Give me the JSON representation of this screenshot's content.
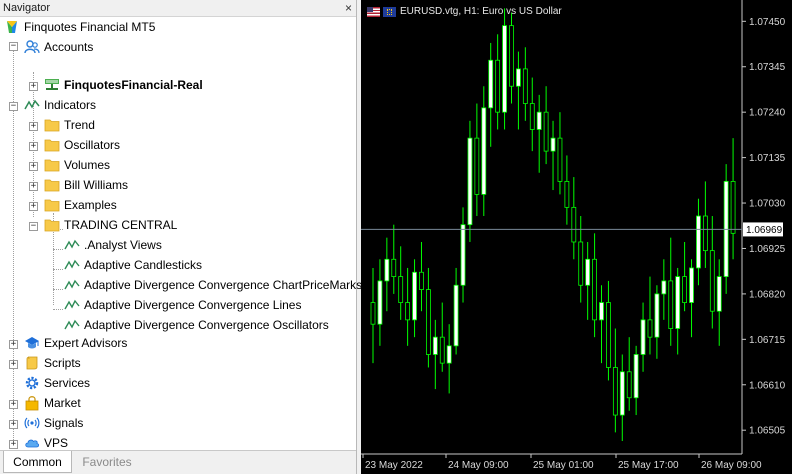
{
  "navigator": {
    "title": "Navigator",
    "close_glyph": "×",
    "root_label": "Finquotes Financial MT5",
    "accounts": {
      "label": "Accounts",
      "account_name": "FinquotesFinancial-Real"
    },
    "indicators": {
      "label": "Indicators",
      "folders": [
        "Trend",
        "Oscillators",
        "Volumes",
        "Bill Williams",
        "Examples",
        "TRADING CENTRAL"
      ],
      "trading_central_items": [
        ".Analyst Views",
        "Adaptive Candlesticks",
        "Adaptive Divergence Convergence ChartPriceMarks",
        "Adaptive Divergence Convergence Lines",
        "Adaptive Divergence Convergence Oscillators"
      ]
    },
    "other_nodes": [
      "Expert Advisors",
      "Scripts",
      "Services",
      "Market",
      "Signals",
      "VPS"
    ],
    "tabs": {
      "common": "Common",
      "favorites": "Favorites"
    }
  },
  "chart": {
    "symbol_title": "EURUSD.vtg, H1:  Euro vs US Dollar",
    "colors": {
      "background": "#000000",
      "bull_candle": "#ffffff",
      "bull_fill": "#00ff00",
      "price_line": "#7a8a99",
      "axis_text": "#d8d8d8",
      "current_price_bg": "#ffffff"
    },
    "current_price": "1.06969",
    "chart_data": {
      "type": "candlestick",
      "title": "EURUSD.vtg, H1:  Euro vs US Dollar",
      "y_ticks": [
        "1.07450",
        "1.07345",
        "1.07240",
        "1.07135",
        "1.07030",
        "1.06925",
        "1.06820",
        "1.06715",
        "1.06610",
        "1.06505"
      ],
      "x_ticks": [
        "23 May 2022",
        "24 May 09:00",
        "25 May 01:00",
        "25 May 17:00",
        "26 May 09:00"
      ],
      "ylim": [
        1.0645,
        1.0749
      ],
      "current_price": 1.06969,
      "candles": [
        [
          1.068,
          1.0688,
          1.0666,
          1.0675
        ],
        [
          1.0675,
          1.069,
          1.067,
          1.0685
        ],
        [
          1.0685,
          1.0695,
          1.0678,
          1.069
        ],
        [
          1.069,
          1.0698,
          1.0682,
          1.0686
        ],
        [
          1.0686,
          1.0693,
          1.0676,
          1.068
        ],
        [
          1.068,
          1.0688,
          1.067,
          1.0676
        ],
        [
          1.0676,
          1.069,
          1.0672,
          1.0687
        ],
        [
          1.0687,
          1.0694,
          1.0678,
          1.0683
        ],
        [
          1.0683,
          1.0688,
          1.0665,
          1.0668
        ],
        [
          1.0668,
          1.0676,
          1.066,
          1.0672
        ],
        [
          1.0672,
          1.068,
          1.0664,
          1.0666
        ],
        [
          1.0666,
          1.0675,
          1.0659,
          1.067
        ],
        [
          1.067,
          1.0688,
          1.0668,
          1.0684
        ],
        [
          1.0684,
          1.0702,
          1.068,
          1.0698
        ],
        [
          1.0698,
          1.0722,
          1.0694,
          1.0718
        ],
        [
          1.0718,
          1.0726,
          1.07,
          1.0705
        ],
        [
          1.0705,
          1.073,
          1.07,
          1.0725
        ],
        [
          1.0725,
          1.074,
          1.0716,
          1.0736
        ],
        [
          1.0736,
          1.0742,
          1.072,
          1.0724
        ],
        [
          1.0724,
          1.0748,
          1.072,
          1.0744
        ],
        [
          1.0744,
          1.0747,
          1.0726,
          1.073
        ],
        [
          1.073,
          1.0738,
          1.072,
          1.0734
        ],
        [
          1.0734,
          1.0739,
          1.0722,
          1.0726
        ],
        [
          1.0726,
          1.0732,
          1.0715,
          1.072
        ],
        [
          1.072,
          1.0728,
          1.071,
          1.0724
        ],
        [
          1.0724,
          1.073,
          1.0712,
          1.0715
        ],
        [
          1.0715,
          1.0722,
          1.0706,
          1.0718
        ],
        [
          1.0718,
          1.0724,
          1.0705,
          1.0708
        ],
        [
          1.0708,
          1.0714,
          1.0698,
          1.0702
        ],
        [
          1.0702,
          1.0709,
          1.069,
          1.0694
        ],
        [
          1.0694,
          1.07,
          1.068,
          1.0684
        ],
        [
          1.0684,
          1.0694,
          1.0676,
          1.069
        ],
        [
          1.069,
          1.0696,
          1.0672,
          1.0676
        ],
        [
          1.0676,
          1.0684,
          1.0666,
          1.068
        ],
        [
          1.068,
          1.0685,
          1.0662,
          1.0665
        ],
        [
          1.0665,
          1.0674,
          1.065,
          1.0654
        ],
        [
          1.0654,
          1.0668,
          1.0648,
          1.0664
        ],
        [
          1.0664,
          1.0672,
          1.0655,
          1.0658
        ],
        [
          1.0658,
          1.067,
          1.0654,
          1.0668
        ],
        [
          1.0668,
          1.068,
          1.0664,
          1.0676
        ],
        [
          1.0676,
          1.0686,
          1.0668,
          1.0672
        ],
        [
          1.0672,
          1.0684,
          1.0667,
          1.0682
        ],
        [
          1.0682,
          1.069,
          1.0676,
          1.0685
        ],
        [
          1.0685,
          1.0695,
          1.067,
          1.0674
        ],
        [
          1.0674,
          1.0688,
          1.0668,
          1.0686
        ],
        [
          1.0686,
          1.0694,
          1.0678,
          1.068
        ],
        [
          1.068,
          1.069,
          1.0672,
          1.0688
        ],
        [
          1.0688,
          1.0704,
          1.0684,
          1.07
        ],
        [
          1.07,
          1.0708,
          1.0688,
          1.0692
        ],
        [
          1.0692,
          1.07,
          1.0674,
          1.0678
        ],
        [
          1.0678,
          1.069,
          1.067,
          1.0686
        ],
        [
          1.0686,
          1.0712,
          1.0682,
          1.0708
        ],
        [
          1.0708,
          1.0718,
          1.069,
          1.0696
        ]
      ]
    }
  }
}
